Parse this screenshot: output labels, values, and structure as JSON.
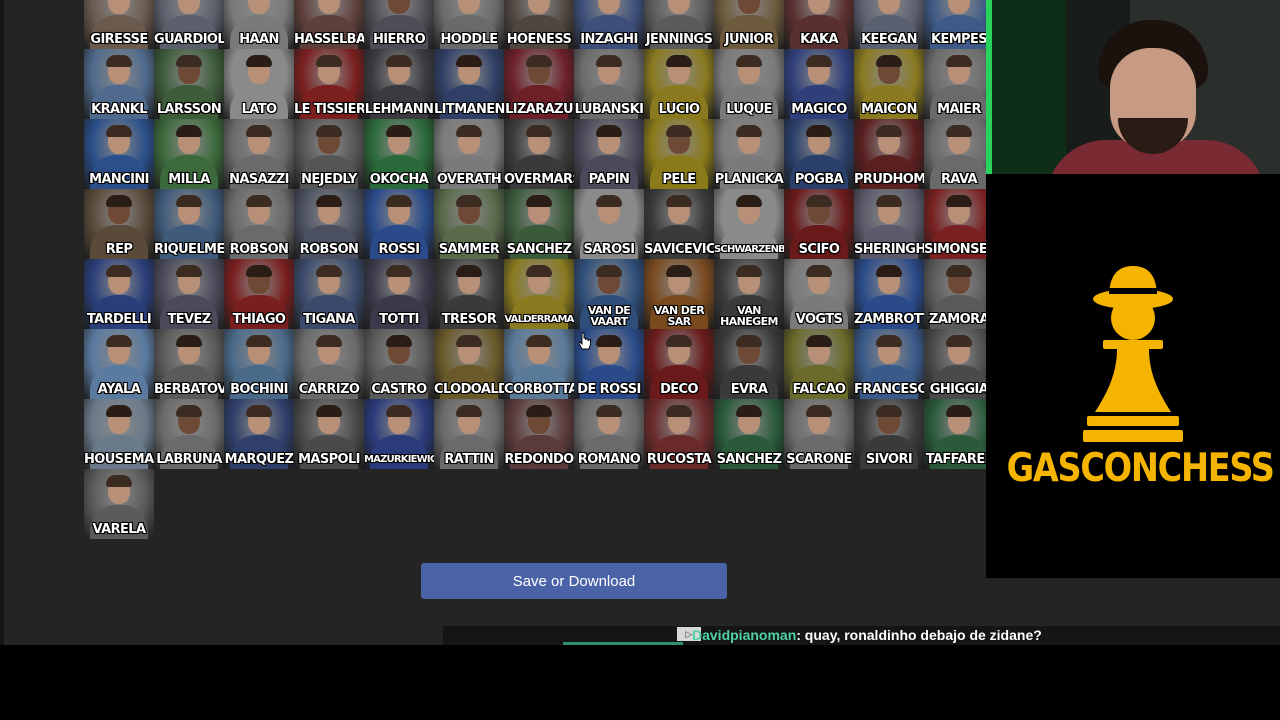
{
  "players": [
    {
      "name": "GIRESSE",
      "tone": "#6b5a4e"
    },
    {
      "name": "GUARDIOLA",
      "tone": "#5a5f6b"
    },
    {
      "name": "HAAN",
      "tone": "#7a7a7a"
    },
    {
      "name": "HASSELBAINK",
      "tone": "#5e3f3a"
    },
    {
      "name": "HIERRO",
      "tone": "#4d4d55"
    },
    {
      "name": "HODDLE",
      "tone": "#6a6a6a"
    },
    {
      "name": "HOENESS",
      "tone": "#4f4640"
    },
    {
      "name": "INZAGHI",
      "tone": "#3d4f7a"
    },
    {
      "name": "JENNINGS",
      "tone": "#5b5b5b"
    },
    {
      "name": "JUNIOR",
      "tone": "#6d5a3c"
    },
    {
      "name": "KAKA",
      "tone": "#5a2f2f"
    },
    {
      "name": "KEEGAN",
      "tone": "#5b6070"
    },
    {
      "name": "KEMPES",
      "tone": "#3e5a86"
    },
    {
      "name": "KRANKL",
      "tone": "#4f6a8c"
    },
    {
      "name": "LARSSON",
      "tone": "#3d5c3a"
    },
    {
      "name": "LATO",
      "tone": "#8a8a8a"
    },
    {
      "name": "LE TISSIER",
      "tone": "#7b1f1f"
    },
    {
      "name": "LEHMANN",
      "tone": "#3a3a40"
    },
    {
      "name": "LITMANEN",
      "tone": "#2f3f66"
    },
    {
      "name": "LIZARAZU",
      "tone": "#6e2028"
    },
    {
      "name": "LUBANSKI",
      "tone": "#6b6b6b"
    },
    {
      "name": "LUCIO",
      "tone": "#8a7a1f"
    },
    {
      "name": "LUQUE",
      "tone": "#7a7a7a"
    },
    {
      "name": "MAGICO",
      "tone": "#2f3f7a"
    },
    {
      "name": "MAICON",
      "tone": "#8a7a20"
    },
    {
      "name": "MAIER",
      "tone": "#6a6a6a"
    },
    {
      "name": "MANCINI",
      "tone": "#2a4f8a"
    },
    {
      "name": "MILLA",
      "tone": "#3c6a3c"
    },
    {
      "name": "NASAZZI",
      "tone": "#6a6a6a"
    },
    {
      "name": "NEJEDLY",
      "tone": "#555"
    },
    {
      "name": "OKOCHA",
      "tone": "#2a6a3a"
    },
    {
      "name": "OVERATH",
      "tone": "#7a7a7a"
    },
    {
      "name": "OVERMARS",
      "tone": "#3a3a3a"
    },
    {
      "name": "PAPIN",
      "tone": "#4a4a5a"
    },
    {
      "name": "PELE",
      "tone": "#8a7a1a"
    },
    {
      "name": "PLANICKA",
      "tone": "#7a7a7a"
    },
    {
      "name": "POGBA",
      "tone": "#2a3f6a"
    },
    {
      "name": "PRUDHOMME",
      "tone": "#5a1f1f"
    },
    {
      "name": "RAVA",
      "tone": "#6a6a6a"
    },
    {
      "name": "REP",
      "tone": "#5a4a3a"
    },
    {
      "name": "RIQUELME",
      "tone": "#3f5a7a"
    },
    {
      "name": "ROBSON",
      "tone": "#6a6a6a"
    },
    {
      "name": "ROBSON",
      "tone": "#4a5060"
    },
    {
      "name": "ROSSI",
      "tone": "#2a4a8a"
    },
    {
      "name": "SAMMER",
      "tone": "#5a6a4a"
    },
    {
      "name": "SANCHEZ",
      "tone": "#3a5a3a"
    },
    {
      "name": "SAROSI",
      "tone": "#8a8a8a"
    },
    {
      "name": "SAVICEVIC",
      "tone": "#3a3a3a"
    },
    {
      "name": "SCHWARZENBECK",
      "tone": "#8a8a8a",
      "small": true
    },
    {
      "name": "SCIFO",
      "tone": "#6a1a1a"
    },
    {
      "name": "SHERINGHAM",
      "tone": "#5a5a6a"
    },
    {
      "name": "SIMONSEN",
      "tone": "#7a2020"
    },
    {
      "name": "TARDELLI",
      "tone": "#2a3f7a"
    },
    {
      "name": "TEVEZ",
      "tone": "#4a4a5a"
    },
    {
      "name": "THIAGO",
      "tone": "#7a1f1f"
    },
    {
      "name": "TIGANA",
      "tone": "#3a4a6a"
    },
    {
      "name": "TOTTI",
      "tone": "#3a3a4a"
    },
    {
      "name": "TRESOR",
      "tone": "#3a3a3a"
    },
    {
      "name": "VALDERRAMA",
      "tone": "#8a7a20",
      "small": true
    },
    {
      "name": "VAN DE VAART",
      "tone": "#2f4f7a",
      "two": true
    },
    {
      "name": "VAN DER SAR",
      "tone": "#7a4a1f",
      "two": true
    },
    {
      "name": "VAN HANEGEM",
      "tone": "#3a3a3a",
      "two": true
    },
    {
      "name": "VOGTS",
      "tone": "#7a7a7a"
    },
    {
      "name": "ZAMBROTTA",
      "tone": "#2a4a8a"
    },
    {
      "name": "ZAMORA",
      "tone": "#5a5a5a"
    },
    {
      "name": "AYALA",
      "tone": "#5a7aa0"
    },
    {
      "name": "BERBATOV",
      "tone": "#5a5a5a"
    },
    {
      "name": "BOCHINI",
      "tone": "#4a6a8a"
    },
    {
      "name": "CARRIZO",
      "tone": "#6a6a6a"
    },
    {
      "name": "CASTRO",
      "tone": "#5a5a5a"
    },
    {
      "name": "CLODOALDO",
      "tone": "#6a5a2a"
    },
    {
      "name": "CORBOTTA",
      "tone": "#5a7a9a"
    },
    {
      "name": "DE ROSSI",
      "tone": "#2a4a8a"
    },
    {
      "name": "DECO",
      "tone": "#6a1a1a"
    },
    {
      "name": "EVRA",
      "tone": "#3a3a3a"
    },
    {
      "name": "FALCAO",
      "tone": "#6a6a2a"
    },
    {
      "name": "FRANCESCOLI",
      "tone": "#3a5a8a"
    },
    {
      "name": "GHIGGIA",
      "tone": "#4a4a4a"
    },
    {
      "name": "HOUSEMAN",
      "tone": "#6a7a8a"
    },
    {
      "name": "LABRUNA",
      "tone": "#6a6a6a"
    },
    {
      "name": "MARQUEZ",
      "tone": "#2f3f6a"
    },
    {
      "name": "MASPOLI",
      "tone": "#4a4a4a"
    },
    {
      "name": "MAZURKIEWICZ",
      "tone": "#2a3a7a",
      "small": true
    },
    {
      "name": "RATTIN",
      "tone": "#6a6a6a"
    },
    {
      "name": "REDONDO",
      "tone": "#5a3a3a"
    },
    {
      "name": "ROMANO",
      "tone": "#6a6a6a"
    },
    {
      "name": "RUCOSTA",
      "tone": "#6a2a2a"
    },
    {
      "name": "SANCHEZ",
      "tone": "#2a5a3a"
    },
    {
      "name": "SCARONE",
      "tone": "#6a6a6a"
    },
    {
      "name": "SIVORI",
      "tone": "#3a3a3a"
    },
    {
      "name": "TAFFAREL",
      "tone": "#2a5a3a"
    },
    {
      "name": "VARELA",
      "tone": "#5a5a5a"
    }
  ],
  "save_button": {
    "label": "Save or Download",
    "color": "#4a63a7"
  },
  "chat": {
    "username": "Davidpianoman",
    "message": ": quay, ronaldinho debajo de zidane?",
    "ad_icon": "ad-icon"
  },
  "overlay": {
    "brand": "GASCONCHESS",
    "brand_color": "#f4b400",
    "logo_icon": "pawn-hat-icon",
    "webcam_label": "webcam"
  }
}
